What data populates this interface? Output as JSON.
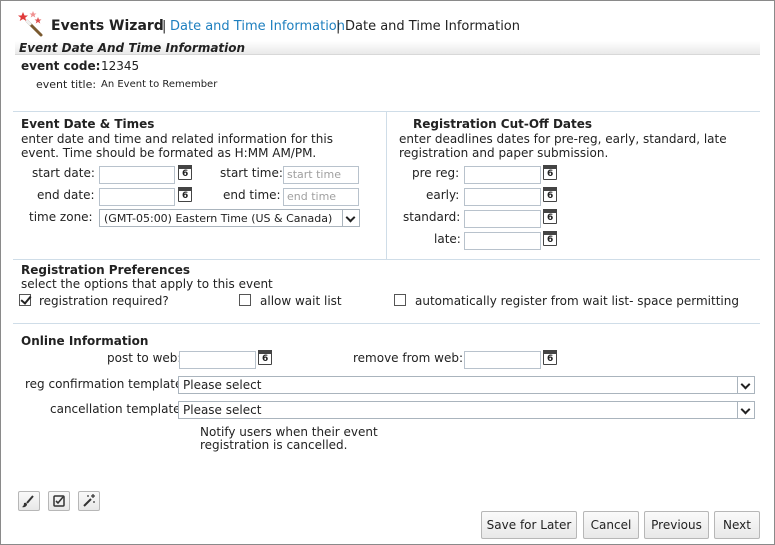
{
  "header": {
    "title": "Events Wizard",
    "sep1": "|",
    "link": "Date and Time Information",
    "sep2": "|",
    "crumb": "Date and Time Information"
  },
  "section_title": "Event Date And Time Information",
  "event": {
    "code_label": "event code:",
    "code_value": "12345",
    "title_label": "event title:",
    "title_value": "An Event to Remember"
  },
  "dates": {
    "heading": "Event Date & Times",
    "desc1": "enter date and time and related information for this",
    "desc2": "event. Time should be formated as H:MM AM/PM.",
    "start_date_label": "start date:",
    "end_date_label": "end date:",
    "start_time_label": "start time:",
    "end_time_label": "end time:",
    "start_time_placeholder": "start time",
    "end_time_placeholder": "end time",
    "timezone_label": "time zone:",
    "timezone_value": "(GMT-05:00) Eastern Time (US & Canada)",
    "cal_day": "6"
  },
  "cutoff": {
    "heading": "Registration Cut-Off Dates",
    "desc1": "enter deadlines dates for pre-reg, early, standard, late",
    "desc2": "registration and paper submission.",
    "pre_reg_label": "pre reg:",
    "early_label": "early:",
    "standard_label": "standard:",
    "late_label": "late:"
  },
  "prefs": {
    "heading": "Registration Preferences",
    "desc": "select the options that apply to this event",
    "opt1": "registration required?",
    "opt1_checked": true,
    "opt2": "allow wait list",
    "opt3": "automatically register from wait list- space permitting"
  },
  "online": {
    "heading": "Online Information",
    "post_label": "post to web:",
    "remove_label": "remove from web:",
    "reg_template_label": "reg confirmation template:",
    "reg_template_value": "Please select",
    "cancel_template_label": "cancellation template:",
    "cancel_template_value": "Please select",
    "notify1": "Notify users when their event",
    "notify2": "registration is cancelled."
  },
  "footer": {
    "save_later": "Save for Later",
    "cancel": "Cancel",
    "previous": "Previous",
    "next": "Next"
  },
  "colors": {
    "link": "#1d7fbf",
    "divider": "#cfdde8"
  }
}
